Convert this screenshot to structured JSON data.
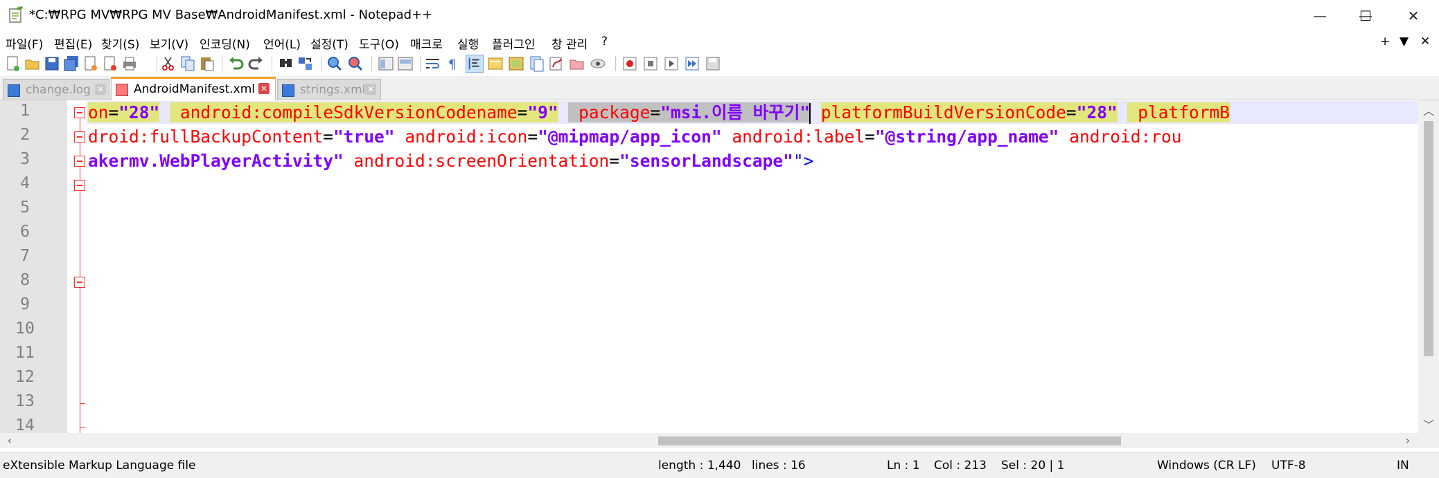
{
  "window": {
    "title": "*C:₩RPG MV₩RPG MV Base₩AndroidManifest.xml - Notepad++",
    "minimize_glyph": "—",
    "maximize_glyph": "☐",
    "close_glyph": "✕"
  },
  "menu": {
    "items": [
      "파일(F)",
      "편집(E)",
      "찾기(S)",
      "보기(V)",
      "인코딩(N)",
      "언어(L)",
      "설정(T)",
      "도구(O)",
      "매크로",
      "실행",
      "플러그인",
      "창 관리",
      "?"
    ],
    "right": [
      "+",
      "▼",
      "✕"
    ]
  },
  "toolbar": {
    "icons": [
      "new-file-icon",
      "open-file-icon",
      "save-icon",
      "save-all-icon",
      "close-icon",
      "close-all-icon",
      "print-icon",
      "cut-icon",
      "copy-icon",
      "paste-icon",
      "undo-icon",
      "redo-icon",
      "find-icon",
      "replace-icon",
      "zoom-in-icon",
      "zoom-out-icon",
      "sync-vertical-icon",
      "sync-horizontal-icon",
      "word-wrap-icon",
      "show-all-chars-icon",
      "indent-guide-icon",
      "user-defined-language-icon",
      "document-map-icon",
      "function-list-icon",
      "folder-as-workspace-icon",
      "monitoring-icon",
      "start-recording-icon",
      "stop-recording-icon",
      "playback-icon",
      "run-macro-multiple-icon",
      "save-macro-icon"
    ]
  },
  "tabs": [
    {
      "label": "change.log",
      "active": false
    },
    {
      "label": "AndroidManifest.xml",
      "active": true
    },
    {
      "label": "strings.xml",
      "active": false
    }
  ],
  "editor": {
    "line_numbers": [
      "1",
      "2",
      "3",
      "4",
      "5",
      "6",
      "7",
      "8",
      "9",
      "10",
      "11",
      "12",
      "13",
      "14"
    ],
    "line1": {
      "a1": "on",
      "v1": "\"28\"",
      "a2": "android:compileSdkVersionCodename",
      "v2": "\"9\"",
      "a3": "package",
      "v3": "\"msi.이름 바꾸기\"",
      "a4": "platformBuildVersionCode",
      "v4": "\"28\"",
      "a5": "platformB"
    },
    "line2": {
      "a1": "droid:fullBackupContent",
      "v1": "\"true\"",
      "a2": "android:icon",
      "v2": "\"@mipmap/app_icon\"",
      "a3": "android:label",
      "v3": "\"@string/app_name\"",
      "a4": "android:rou"
    },
    "line3": {
      "v1": "akermv.WebPlayerActivity\"",
      "a2": "android:screenOrientation",
      "v2": "\"sensorLandscape\"",
      "t1": "\">"
    },
    "eq": "="
  },
  "status": {
    "file_type": "eXtensible Markup Language file",
    "length": "length : 1,440",
    "lines": "lines : 16",
    "ln": "Ln : 1",
    "col": "Col : 213",
    "sel": "Sel : 20 | 1",
    "eol": "Windows (CR LF)",
    "encoding": "UTF-8",
    "mode": "IN"
  },
  "colors": {
    "attribute": "#ff0000",
    "value": "#8000ff",
    "tag": "#0000ff",
    "highlight": "#e3e67c",
    "active_tab_accent": "#f7a125"
  }
}
